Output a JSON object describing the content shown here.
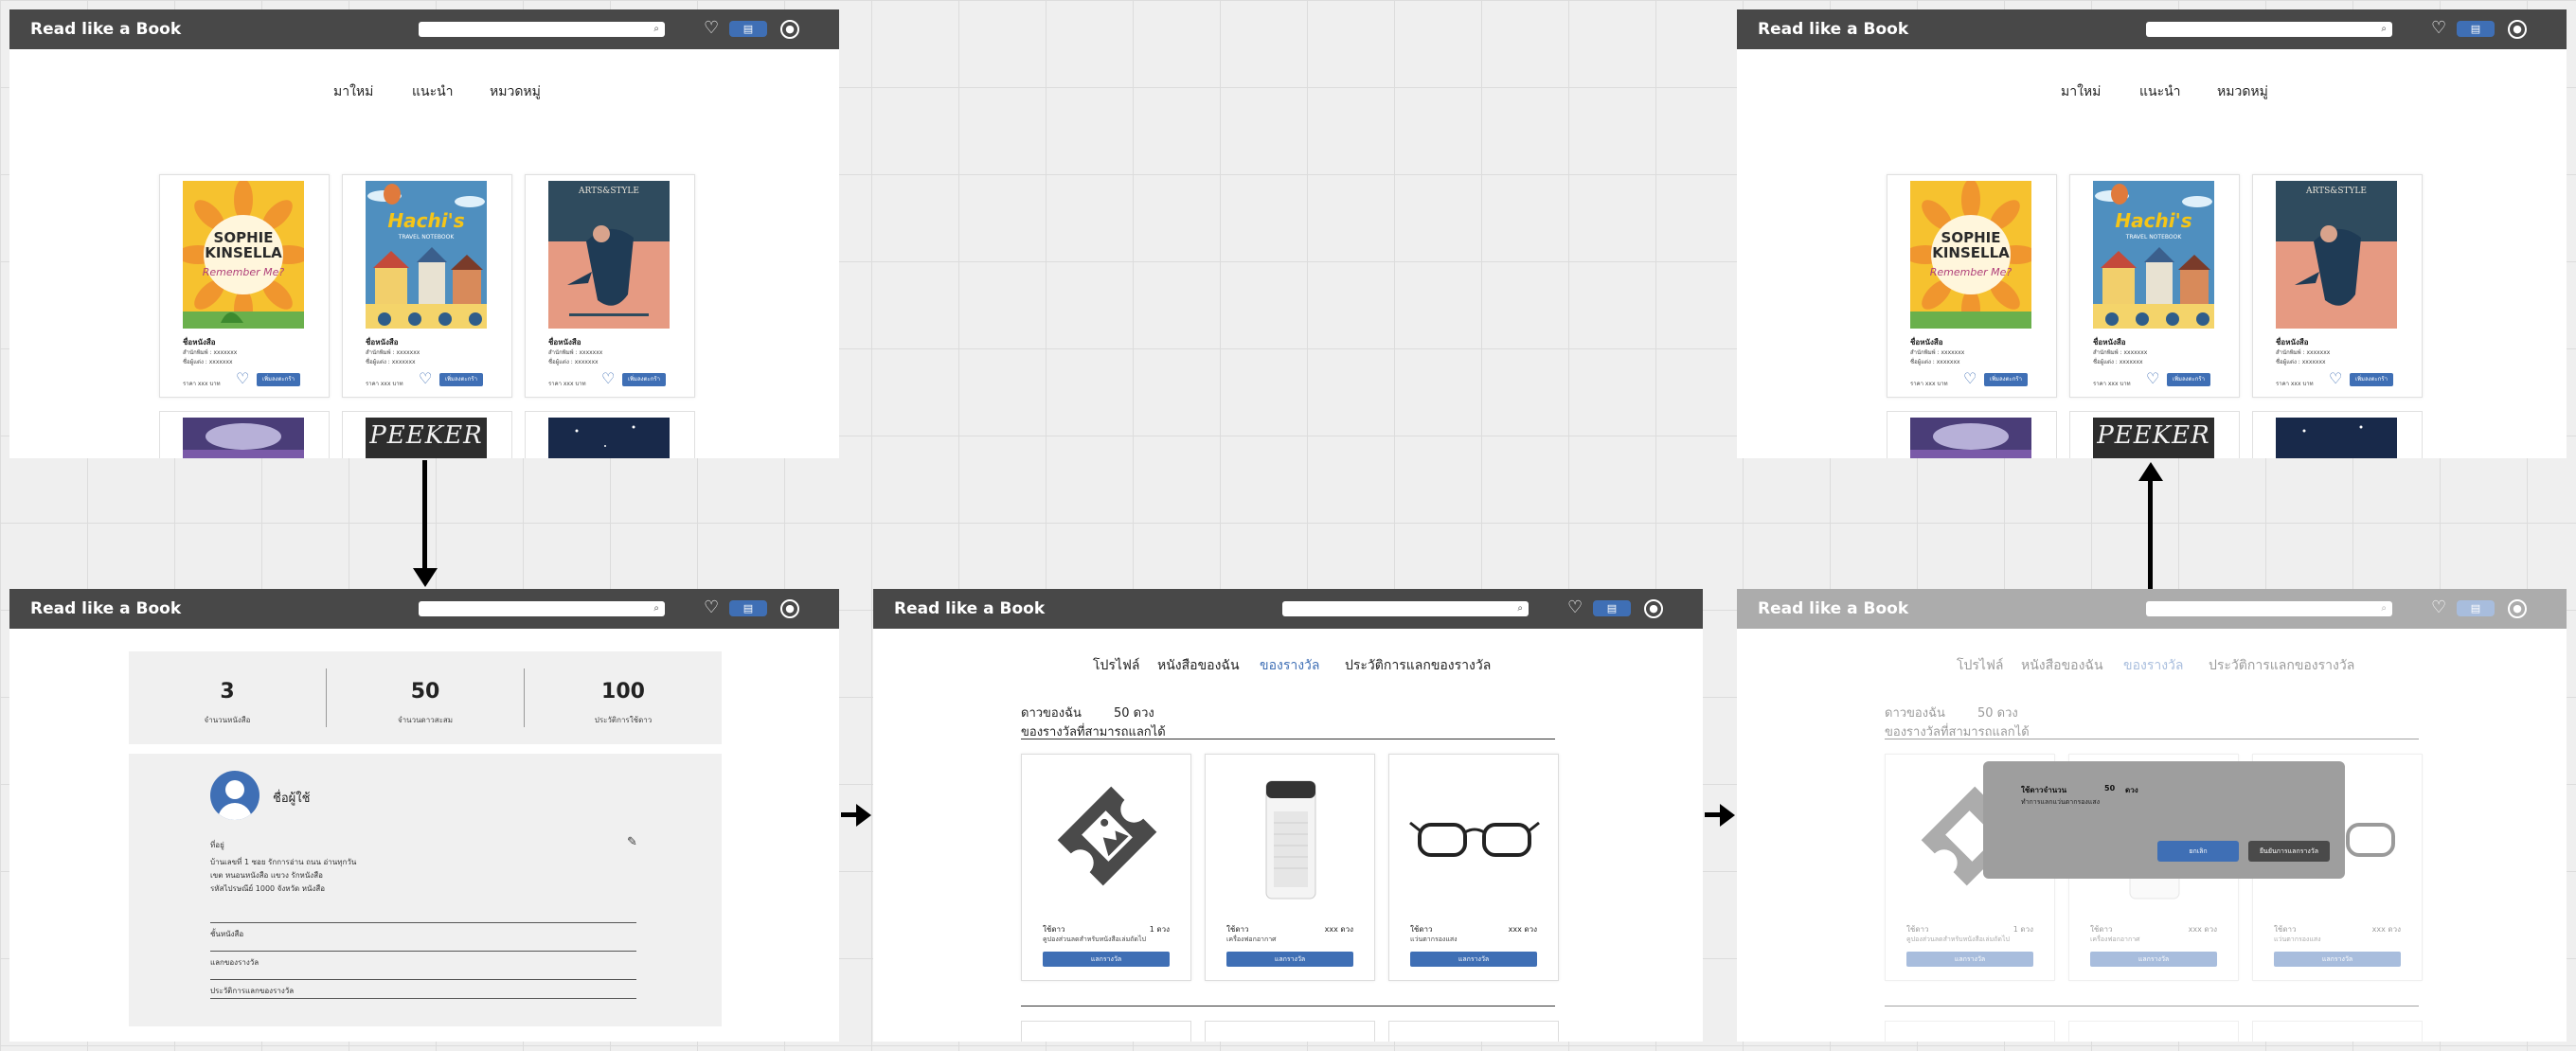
{
  "brand": "Read like a  Book",
  "home": {
    "nav": [
      "มาใหม่",
      "แนะนำ",
      "หมวดหมู่"
    ],
    "book_title": "ชื่อหนังสือ",
    "book_publisher": "สำนักพิมพ์ : xxxxxxx",
    "book_author": "ชื่อผู้แต่ง : xxxxxxx",
    "book_price": "ราคา xxx บาท",
    "add_to_cart": "เพิ่มลงตะกร้า",
    "covers": [
      {
        "title": "SOPHIE KINSELLA",
        "subtitle": "Remember Me?"
      },
      {
        "title": "Hachi's",
        "subtitle": "TRAVEL NOTEBOOK"
      },
      {
        "title": "ARTS&STYLE",
        "subtitle": ""
      }
    ],
    "cover2_row2": "PEEKER"
  },
  "profile": {
    "stats": [
      {
        "num": "3",
        "label": "จำนวนหนังสือ"
      },
      {
        "num": "50",
        "label": "จำนวนดาวสะสม"
      },
      {
        "num": "100",
        "label": "ประวัติการใช้ดาว"
      }
    ],
    "username": "ชื่อผู้ใช้",
    "address_title": "ที่อยู่",
    "address_lines": [
      "บ้านเลขที่ 1   ซอย รักการอ่าน   ถนน อ่านทุกวัน",
      "เขต หนอนหนังสือ   แขวง รักหนังสือ",
      "รหัสไปรษณีย์ 1000   จังหวัด หนังสือ"
    ],
    "menu": [
      "ชั้นหนังสือ",
      "แลกของรางวัล",
      "ประวัติการแลกของรางวัล"
    ]
  },
  "rewards": {
    "tabs": [
      "โปรไฟล์",
      "หนังสือของฉัน",
      "ของรางวัล",
      "ประวัติการแลกของรางวัล"
    ],
    "active_tab": "ของรางวัล",
    "stars_label": "ดาวของฉัน",
    "stars_value": "50  ดวง",
    "section_title": "ของรางวัลที่สามารถแลกได้",
    "items": [
      {
        "cost_label": "ใช้ดาว",
        "cost": "1  ดวง",
        "desc": "คูปองส่วนลดสำหรับหนังสือเล่มถัดไป",
        "button": "แลกรางวัล"
      },
      {
        "cost_label": "ใช้ดาว",
        "cost": "xxx  ดวง",
        "desc": "เครื่องฟอกอากาศ",
        "button": "แลกรางวัล"
      },
      {
        "cost_label": "ใช้ดาว",
        "cost": "xxx  ดวง",
        "desc": "แว่นตากรองแสง",
        "button": "แลกรางวัล"
      }
    ]
  },
  "modal": {
    "line1_label": "ใช้ดาวจำนวน",
    "line1_value": "50",
    "line1_unit": "ดวง",
    "line2": "ทำการแลกแว่นตากรองแสง",
    "cancel": "ยกเลิก",
    "confirm": "ยืนยันการแลกรางวัล"
  },
  "colors": {
    "topbar": "#484848",
    "accent": "#3f6fb5"
  }
}
